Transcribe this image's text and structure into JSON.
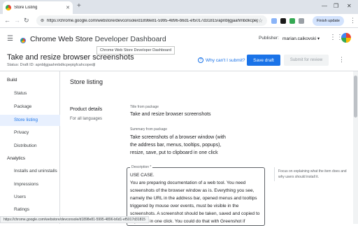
{
  "browser": {
    "tab_title": "Store Listing",
    "url": "https://chrome.google.com/webstore/devconsole/d1898e81-5995-4896-b6d1-ef5017d31815/apnbljgjaahmbdkcpepigfc...",
    "finish_update": "Finish update",
    "status_url": "https://chrome.google.com/webstore/devconsole/d1898e81-5995-4896-b6d1-ef5017d31815"
  },
  "header": {
    "app_title_main": "Chrome Web Store",
    "app_title_sub": "Developer Dashboard",
    "tooltip": "Chrome Web Store Developer Dashboard",
    "publisher_label": "Publisher:",
    "publisher_name": "marian.caikovski ▾"
  },
  "item": {
    "title": "Take and resize browser screenshots",
    "status": "Status: Draft   ID: apnbljgjaahmbdkcpepigfcahcopedjl",
    "why_label": "Why can't I submit?",
    "save_label": "Save draft",
    "submit_label": "Submit for review"
  },
  "sidebar": {
    "build_label": "Build",
    "build_items": [
      "Status",
      "Package",
      "Store listing",
      "Privacy",
      "Distribution"
    ],
    "analytics_label": "Analytics",
    "analytics_items": [
      "Installs and uninstalls",
      "Impressions",
      "Users",
      "Ratings"
    ]
  },
  "main": {
    "heading": "Store listing",
    "product_details": "Product details",
    "for_all_languages": "For all languages",
    "title_label": "Title from package",
    "title_value": "Take and resize browser screenshots",
    "summary_label": "Summary from package",
    "summary_value": "Take screenshots of a browser window (with the address bar, menus, tooltips, popups), resize, save, put to clipboard in one click",
    "description_label": "Description *",
    "description_value": "USE CASE.\nYou are preparing documentation of a web tool. You need screenshots of the browser window as is. Everything you see, namely the URL in the address bar, opened menus and tooltips triggered by mouse over events, must be visible in the screenshots. A screenshot should be taken, saved and copied to clipboard in one click. You could do that with Greenshot if",
    "hint": "Focus on explaining what the item does and why users should install it."
  }
}
